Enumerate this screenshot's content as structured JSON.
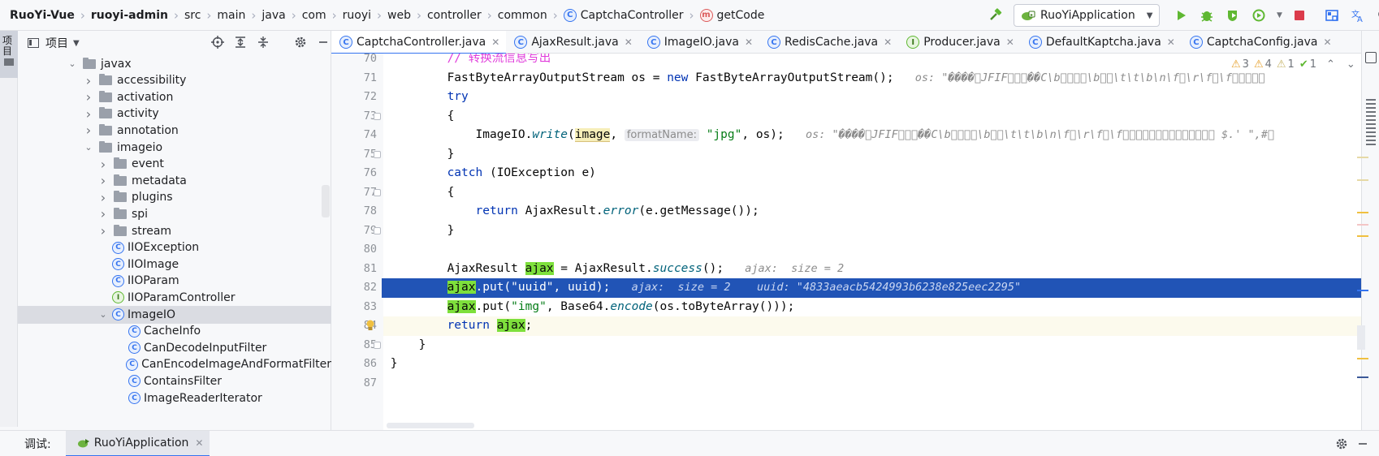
{
  "breadcrumb": [
    "RuoYi-Vue",
    "ruoyi-admin",
    "src",
    "main",
    "java",
    "com",
    "ruoyi",
    "web",
    "controller",
    "common",
    "CaptchaController",
    "getCode"
  ],
  "toolbar": {
    "run_config": "RuoYiApplication"
  },
  "left_stripe": {
    "project_label": "项目"
  },
  "project_panel": {
    "title": "项目"
  },
  "tree": [
    {
      "label": "javax",
      "expanded": true,
      "type": "folder",
      "level": 0
    },
    {
      "label": "accessibility",
      "expanded": false,
      "type": "folder",
      "level": 1
    },
    {
      "label": "activation",
      "expanded": false,
      "type": "folder",
      "level": 1
    },
    {
      "label": "activity",
      "expanded": false,
      "type": "folder",
      "level": 1
    },
    {
      "label": "annotation",
      "expanded": false,
      "type": "folder",
      "level": 1
    },
    {
      "label": "imageio",
      "expanded": true,
      "type": "folder",
      "level": 1
    },
    {
      "label": "event",
      "expanded": false,
      "type": "folder",
      "level": 2
    },
    {
      "label": "metadata",
      "expanded": false,
      "type": "folder",
      "level": 2
    },
    {
      "label": "plugins",
      "expanded": false,
      "type": "folder",
      "level": 2
    },
    {
      "label": "spi",
      "expanded": false,
      "type": "folder",
      "level": 2
    },
    {
      "label": "stream",
      "expanded": false,
      "type": "folder",
      "level": 2
    },
    {
      "label": "IIOException",
      "type": "class",
      "level": 2
    },
    {
      "label": "IIOImage",
      "type": "class",
      "level": 2
    },
    {
      "label": "IIOParam",
      "type": "class",
      "level": 2
    },
    {
      "label": "IIOParamController",
      "type": "interface",
      "level": 2
    },
    {
      "label": "ImageIO",
      "type": "class",
      "expanded": true,
      "selected": true,
      "level": 2
    },
    {
      "label": "CacheInfo",
      "type": "class",
      "level": 3
    },
    {
      "label": "CanDecodeInputFilter",
      "type": "class",
      "level": 3
    },
    {
      "label": "CanEncodeImageAndFormatFilter",
      "type": "class",
      "level": 3
    },
    {
      "label": "ContainsFilter",
      "type": "class",
      "level": 3
    },
    {
      "label": "ImageReaderIterator",
      "type": "class",
      "level": 3
    }
  ],
  "tabs": [
    {
      "label": "CaptchaController.java",
      "icon": "C",
      "active": true
    },
    {
      "label": "AjaxResult.java",
      "icon": "C"
    },
    {
      "label": "ImageIO.java",
      "icon": "C"
    },
    {
      "label": "RedisCache.java",
      "icon": "C"
    },
    {
      "label": "Producer.java",
      "icon": "I"
    },
    {
      "label": "DefaultKaptcha.java",
      "icon": "C"
    },
    {
      "label": "CaptchaConfig.java",
      "icon": "C"
    }
  ],
  "inspections": {
    "warnings": "3",
    "weak": "4",
    "info": "1",
    "ok": "1"
  },
  "code": {
    "l70": {
      "num": "70",
      "comment": "// 转换流信息写出"
    },
    "l71": {
      "num": "71",
      "a": "FastByteArrayOutputStream os = ",
      "kw": "new",
      "b": " FastByteArrayOutputStream();",
      "hint": "os: \"����\u0000JFIF\u0000\u0000\u0000��C\\b\u0000\u0000\u0000\u0000\\b\u0000\u0000\\t\\t\\b\\n\\f\u0000\\r\\f\u0000\\f\u0000\u0000\u0000\u0000\u0000"
    },
    "l72": {
      "num": "72",
      "kw": "try"
    },
    "l73": {
      "num": "73",
      "text": "{"
    },
    "l74": {
      "num": "74",
      "a": "ImageIO.",
      "m": "write",
      "b": "(",
      "v": "image",
      "c": ", ",
      "inlay": "formatName:",
      "s": "\"jpg\"",
      "d": ", os);",
      "hint": "os: \"����\u0000JFIF\u0000\u0000\u0000��C\\b\u0000\u0000\u0000\u0000\\b\u0000\u0000\\t\\t\\b\\n\\f\u0000\\r\\f\u0000\\f\u0000\u0000\u0000\u0000\u0000\u0000\u0000\u0000\u0000\u0000\u0000\u0000\u0000\u0000 $.' \",#\u0000"
    },
    "l75": {
      "num": "75",
      "text": "}"
    },
    "l76": {
      "num": "76",
      "kw": "catch",
      "b": " (IOException e)"
    },
    "l77": {
      "num": "77",
      "text": "{"
    },
    "l78": {
      "num": "78",
      "kw": "return",
      "a": " AjaxResult.",
      "m": "error",
      "b": "(e.getMessage());"
    },
    "l79": {
      "num": "79",
      "text": "}"
    },
    "l80": {
      "num": "80"
    },
    "l81": {
      "num": "81",
      "a": "AjaxResult ",
      "v": "ajax",
      "b": " = AjaxResult.",
      "m": "success",
      "c": "();",
      "hint": "ajax:  size = 2"
    },
    "l82": {
      "num": "82",
      "v": "ajax",
      "a": ".put(\"uuid\", uuid);",
      "hint": "ajax:  size = 2    uuid: \"4833aeacb5424993b6238e825eec2295\""
    },
    "l83": {
      "num": "83",
      "v": "ajax",
      "a": ".put(",
      "s": "\"img\"",
      "b": ", Base64.",
      "m": "encode",
      "c": "(os.toByteArray()));"
    },
    "l84": {
      "num": "84",
      "kw": "return",
      "v": "ajax",
      "a": ";"
    },
    "l85": {
      "num": "85",
      "text": "}"
    },
    "l86": {
      "num": "86",
      "text": "}"
    },
    "l87": {
      "num": "87"
    }
  },
  "bottom": {
    "debug_label": "调试:",
    "run_tab": "RuoYiApplication"
  }
}
